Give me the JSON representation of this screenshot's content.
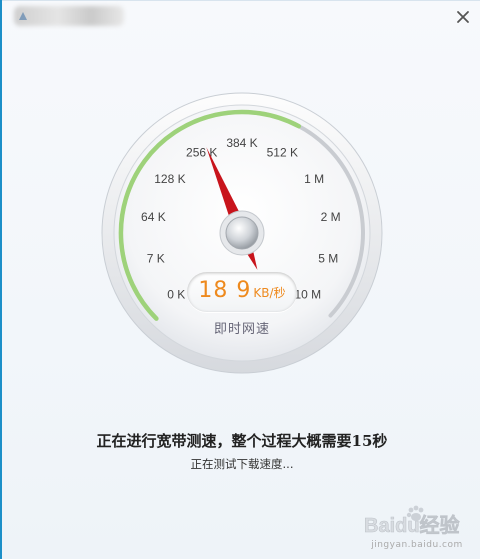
{
  "window": {
    "close_glyph": "×"
  },
  "gauge": {
    "tick_labels": [
      "0 K",
      "7 K",
      "64 K",
      "128 K",
      "256 K",
      "384 K",
      "512 K",
      "1 M",
      "2 M",
      "5 M",
      "10 M"
    ],
    "needle_value": "256 K",
    "speed_value": "18 9",
    "speed_unit": "KB/秒",
    "label": "即时网速",
    "arc_color": "#9ed27a",
    "needle_color": "#c8141c",
    "speed_color": "#ee8a1e"
  },
  "status": {
    "main": "正在进行宽带测速，整个过程大概需要15秒",
    "sub": "正在测试下载速度..."
  },
  "watermark": {
    "brand": "Baidu经验",
    "url": "jingyan.baidu.com"
  },
  "icons": {
    "app": "app-icon",
    "close": "close-icon",
    "paw": "baidu-paw-icon"
  }
}
